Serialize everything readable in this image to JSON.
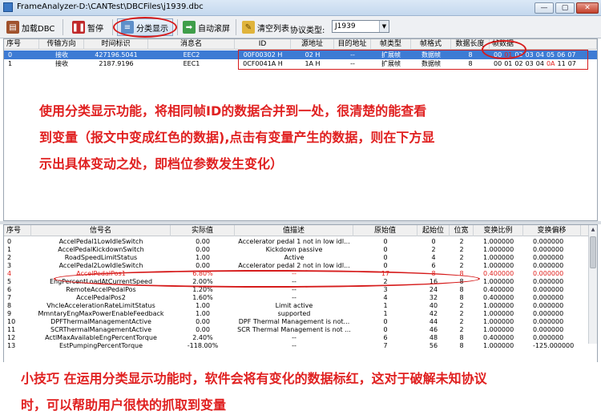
{
  "window": {
    "title": "FrameAnalyzer-D:\\CANTest\\DBCFiles\\j1939.dbc",
    "controls": [
      "—",
      "▢",
      "✕"
    ]
  },
  "toolbar": {
    "load_dbc": "加载DBC",
    "pause": "暂停",
    "classify": "分类显示",
    "autoscroll": "自动滚屏",
    "clear": "清空列表",
    "protocol_label": "协议类型:",
    "protocol_value": "J1939"
  },
  "frames": {
    "columns": [
      "序号",
      "传输方向",
      "时间标识",
      "消息名",
      "ID",
      "源地址",
      "目的地址",
      "帧类型",
      "帧格式",
      "数据长度",
      "帧数据"
    ],
    "rows": [
      {
        "idx": "0",
        "dir": "接收",
        "time": "427196.5041",
        "name": "EEC2",
        "id": "00F00302 H",
        "src": "02 H",
        "dst": "--",
        "type": "扩展帧",
        "fmt": "数据帧",
        "len": "8",
        "bytes": [
          {
            "v": "00",
            "c": false
          },
          {
            "v": "01",
            "c": true
          },
          {
            "v": "02",
            "c": false
          },
          {
            "v": "03",
            "c": false
          },
          {
            "v": "04",
            "c": false
          },
          {
            "v": "05",
            "c": false
          },
          {
            "v": "06",
            "c": false
          },
          {
            "v": "07",
            "c": false
          }
        ]
      },
      {
        "idx": "1",
        "dir": "接收",
        "time": "2187.9196",
        "name": "EEC1",
        "id": "0CF0041A H",
        "src": "1A H",
        "dst": "--",
        "type": "扩展帧",
        "fmt": "数据帧",
        "len": "8",
        "bytes": [
          {
            "v": "00",
            "c": false
          },
          {
            "v": "01",
            "c": false
          },
          {
            "v": "02",
            "c": false
          },
          {
            "v": "03",
            "c": false
          },
          {
            "v": "04",
            "c": false
          },
          {
            "v": "0A",
            "c": true
          },
          {
            "v": "11",
            "c": false
          },
          {
            "v": "07",
            "c": false
          }
        ]
      }
    ]
  },
  "annotation_top": [
    "使用分类显示功能，将相同帧ID的数据合并到一处，很清楚的能查看",
    "到变量（报文中变成红色的数据),点击有变量产生的数据，则在下方显",
    "示出具体变动之处，即档位参数发生变化）"
  ],
  "signals": {
    "columns": [
      "序号",
      "信号名",
      "实际值",
      "值描述",
      "原始值",
      "起始位",
      "位宽",
      "变换比例",
      "变换偏移"
    ],
    "rows": [
      {
        "idx": "0",
        "name": "AccelPedal1LowIdleSwitch",
        "value": "0.00",
        "desc": "Accelerator pedal 1 not in low idl...",
        "raw": "0",
        "start": "0",
        "width": "2",
        "scale": "1.000000",
        "offset": "0.000000",
        "changed": false
      },
      {
        "idx": "1",
        "name": "AccelPedalKickdownSwitch",
        "value": "0.00",
        "desc": "Kickdown passive",
        "raw": "0",
        "start": "2",
        "width": "2",
        "scale": "1.000000",
        "offset": "0.000000",
        "changed": false
      },
      {
        "idx": "2",
        "name": "RoadSpeedLimitStatus",
        "value": "1.00",
        "desc": "Active",
        "raw": "0",
        "start": "4",
        "width": "2",
        "scale": "1.000000",
        "offset": "0.000000",
        "changed": false
      },
      {
        "idx": "3",
        "name": "AccelPedal2LowIdleSwitch",
        "value": "0.00",
        "desc": "Accelerator pedal 2 not in low idl...",
        "raw": "0",
        "start": "6",
        "width": "2",
        "scale": "1.000000",
        "offset": "0.000000",
        "changed": false
      },
      {
        "idx": "4",
        "name": "AccelPedalPos1",
        "value": "6.80%",
        "desc": "--",
        "raw": "17",
        "start": "8",
        "width": "8",
        "scale": "0.400000",
        "offset": "0.000000",
        "changed": true
      },
      {
        "idx": "5",
        "name": "EngPercentLoadAtCurrentSpeed",
        "value": "2.00%",
        "desc": "--",
        "raw": "2",
        "start": "16",
        "width": "8",
        "scale": "1.000000",
        "offset": "0.000000",
        "changed": false
      },
      {
        "idx": "6",
        "name": "RemoteAccelPedalPos",
        "value": "1.20%",
        "desc": "--",
        "raw": "3",
        "start": "24",
        "width": "8",
        "scale": "0.400000",
        "offset": "0.000000",
        "changed": false
      },
      {
        "idx": "7",
        "name": "AccelPedalPos2",
        "value": "1.60%",
        "desc": "--",
        "raw": "4",
        "start": "32",
        "width": "8",
        "scale": "0.400000",
        "offset": "0.000000",
        "changed": false
      },
      {
        "idx": "8",
        "name": "VhcleAccelerationRateLimitStatus",
        "value": "1.00",
        "desc": "Limit active",
        "raw": "1",
        "start": "40",
        "width": "2",
        "scale": "1.000000",
        "offset": "0.000000",
        "changed": false
      },
      {
        "idx": "9",
        "name": "MmntaryEngMaxPowerEnableFeedback",
        "value": "1.00",
        "desc": "supported",
        "raw": "1",
        "start": "42",
        "width": "2",
        "scale": "1.000000",
        "offset": "0.000000",
        "changed": false
      },
      {
        "idx": "10",
        "name": "DPFThermalManagementActive",
        "value": "0.00",
        "desc": "DPF Thermal Management is not...",
        "raw": "0",
        "start": "44",
        "width": "2",
        "scale": "1.000000",
        "offset": "0.000000",
        "changed": false
      },
      {
        "idx": "11",
        "name": "SCRThermalManagementActive",
        "value": "0.00",
        "desc": "SCR Thermal Management is not ...",
        "raw": "0",
        "start": "46",
        "width": "2",
        "scale": "1.000000",
        "offset": "0.000000",
        "changed": false
      },
      {
        "idx": "12",
        "name": "ActlMaxAvailableEngPercentTorque",
        "value": "2.40%",
        "desc": "--",
        "raw": "6",
        "start": "48",
        "width": "8",
        "scale": "0.400000",
        "offset": "0.000000",
        "changed": false
      },
      {
        "idx": "13",
        "name": "EstPumpingPercentTorque",
        "value": "-118.00%",
        "desc": "--",
        "raw": "7",
        "start": "56",
        "width": "8",
        "scale": "1.000000",
        "offset": "-125.000000",
        "changed": false
      }
    ]
  },
  "annotation_bottom": [
    "小技巧 在运用分类显示功能时，软件会将有变化的数据标红，这对于破解未知协议",
    "时，可以帮助用户很快的抓取到变量"
  ]
}
